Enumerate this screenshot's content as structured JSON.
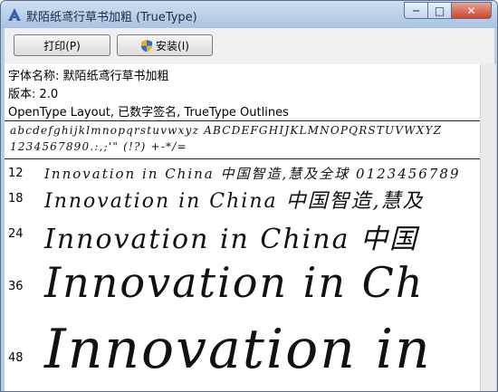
{
  "window": {
    "title": "默陌纸鸢行草书加粗 (TrueType)",
    "controls": {
      "minimize": "─",
      "maximize": "□",
      "close": "✕"
    }
  },
  "toolbar": {
    "print_label": "打印(P)",
    "install_label": "安装(I)"
  },
  "font_info": {
    "name_line": "字体名称: 默陌纸鸢行草书加粗",
    "version_line": "版本: 2.0",
    "features_line": "OpenType Layout, 已数字签名, TrueType Outlines"
  },
  "alphabet": {
    "letters": "abcdefghijklmnopqrstuvwxyz ABCDEFGHIJKLMNOPQRSTUVWXYZ",
    "digits": "1234567890.:,;'\" (!?) +-*/="
  },
  "samples": [
    {
      "size": "12",
      "text": "Innovation in China 中国智造,慧及全球 0123456789"
    },
    {
      "size": "18",
      "text": "Innovation in China 中国智造,慧及"
    },
    {
      "size": "24",
      "text": "Innovation in China 中国"
    },
    {
      "size": "36",
      "text": "Innovation in Ch"
    },
    {
      "size": "48",
      "text": "Innovation in"
    }
  ],
  "colors": {
    "titlebar": "#b7cde6",
    "close_button": "#c9462c"
  }
}
